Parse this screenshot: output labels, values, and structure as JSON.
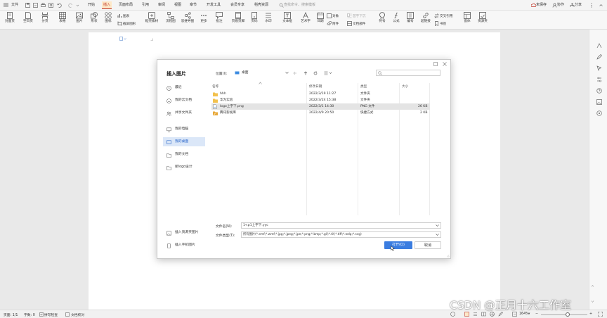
{
  "menubar": {
    "file_label": "文件",
    "tabs": [
      "开始",
      "插入",
      "页面布局",
      "引用",
      "审阅",
      "视图",
      "章节",
      "开发工具",
      "会员专享",
      "稻壳资源"
    ],
    "active_tab": "插入",
    "search_placeholder": "查找命令、搜索模板",
    "unsaved": "未保存",
    "collab": "协作",
    "share": "分享"
  },
  "ribbon": {
    "items": [
      "封面页",
      "空白页",
      "分页",
      "表格",
      "图片",
      "形状",
      "图标",
      "稻壳素材",
      "流程图",
      "思维导图",
      "更多",
      "批注",
      "页眉页脚",
      "页码",
      "水印",
      "文本框",
      "艺术字",
      "日期",
      "附件",
      "符号",
      "公式",
      "编号",
      "超链接",
      "交叉引用",
      "书签",
      "窗体",
      "资源夹"
    ],
    "chart": "图表",
    "screenshot": "截屏图形",
    "object": "对象",
    "headtail": "首字下沉",
    "docparts": "文档部件"
  },
  "dialog": {
    "title": "插入图片",
    "location_label": "位置(I):",
    "location_value": "桌面",
    "sidebar": [
      "最近",
      "我的云文档",
      "共享文件夹",
      "我的电脑",
      "我的桌面",
      "我的文档",
      "新logo设计"
    ],
    "sidebar_bottom": [
      "插入资源夹图片",
      "插入手机图片"
    ],
    "selected_sidebar": "我的桌面",
    "columns": {
      "name": "名称",
      "date": "修改日期",
      "type": "类型",
      "size": "大小"
    },
    "files": [
      {
        "name": "hhh",
        "date": "2022/3/19 11:27",
        "type": "文件夹",
        "size": "",
        "kind": "folder"
      },
      {
        "name": "华为实验",
        "date": "2022/3/24 15:38",
        "type": "文件夹",
        "size": "",
        "kind": "folder"
      },
      {
        "name": "logo上字下.png",
        "date": "2022/3/1 14:30",
        "type": "PNG 文件",
        "size": "26 KB",
        "kind": "image"
      },
      {
        "name": "腾讯影视库",
        "date": "2022/4/9 20:50",
        "type": "快捷方式",
        "size": "2 KB",
        "kind": "shortcut"
      }
    ],
    "filename_label": "文件名(N):",
    "filename_value": "1<p1上字下.yyc",
    "filetype_label": "文件类型(T):",
    "filetype_value": "所有图片(*.emf;*.wmf;*.jpg;*.jpeg;*.jpe;*.png;*.bmp;*.gif;*.tif;*.tiff;*.wdp;*.svg)",
    "open_label": "打开(O)",
    "cancel_label": "取消"
  },
  "status": {
    "page": "页面: 1/1",
    "words": "字数: 0",
    "spell": "拼写检查",
    "proof": "文档校对",
    "zoom": "164%"
  },
  "watermark": "CSDN @正月十六工作室",
  "colors": {
    "accent": "#c0392b",
    "open_button": "#3b7de0",
    "folder": "#f2c14e",
    "selected_side": "#dbe7f8"
  }
}
